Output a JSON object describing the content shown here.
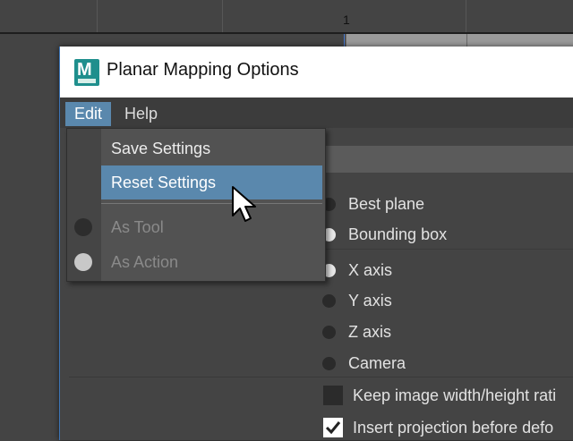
{
  "background": {
    "viewport_marker": "1"
  },
  "window": {
    "title": "Planar Mapping Options",
    "app_icon_letter": "M",
    "menu": [
      {
        "label": "Edit",
        "active": true
      },
      {
        "label": "Help",
        "active": false
      }
    ]
  },
  "dropdown": {
    "items": [
      {
        "label": "Save Settings",
        "state": "normal"
      },
      {
        "label": "Reset Settings",
        "state": "highlighted"
      },
      {
        "label": "As Tool",
        "state": "disabled",
        "radio": "off"
      },
      {
        "label": "As Action",
        "state": "disabled",
        "radio": "on"
      }
    ]
  },
  "options": {
    "fit_projection": [
      {
        "label": "Best plane",
        "selected": false
      },
      {
        "label": "Bounding box",
        "selected": true
      }
    ],
    "projection_source": [
      {
        "label": "X axis",
        "selected": true
      },
      {
        "label": "Y axis",
        "selected": false
      },
      {
        "label": "Z axis",
        "selected": false
      },
      {
        "label": "Camera",
        "selected": false
      }
    ],
    "checkboxes": [
      {
        "label": "Keep image width/height rati",
        "checked": false
      },
      {
        "label": "Insert projection before defo",
        "checked": true
      }
    ]
  },
  "colors": {
    "accent": "#5a88ad",
    "panel": "#444444",
    "titlebar": "#ffffff",
    "app_icon": "#1f8f8d"
  }
}
